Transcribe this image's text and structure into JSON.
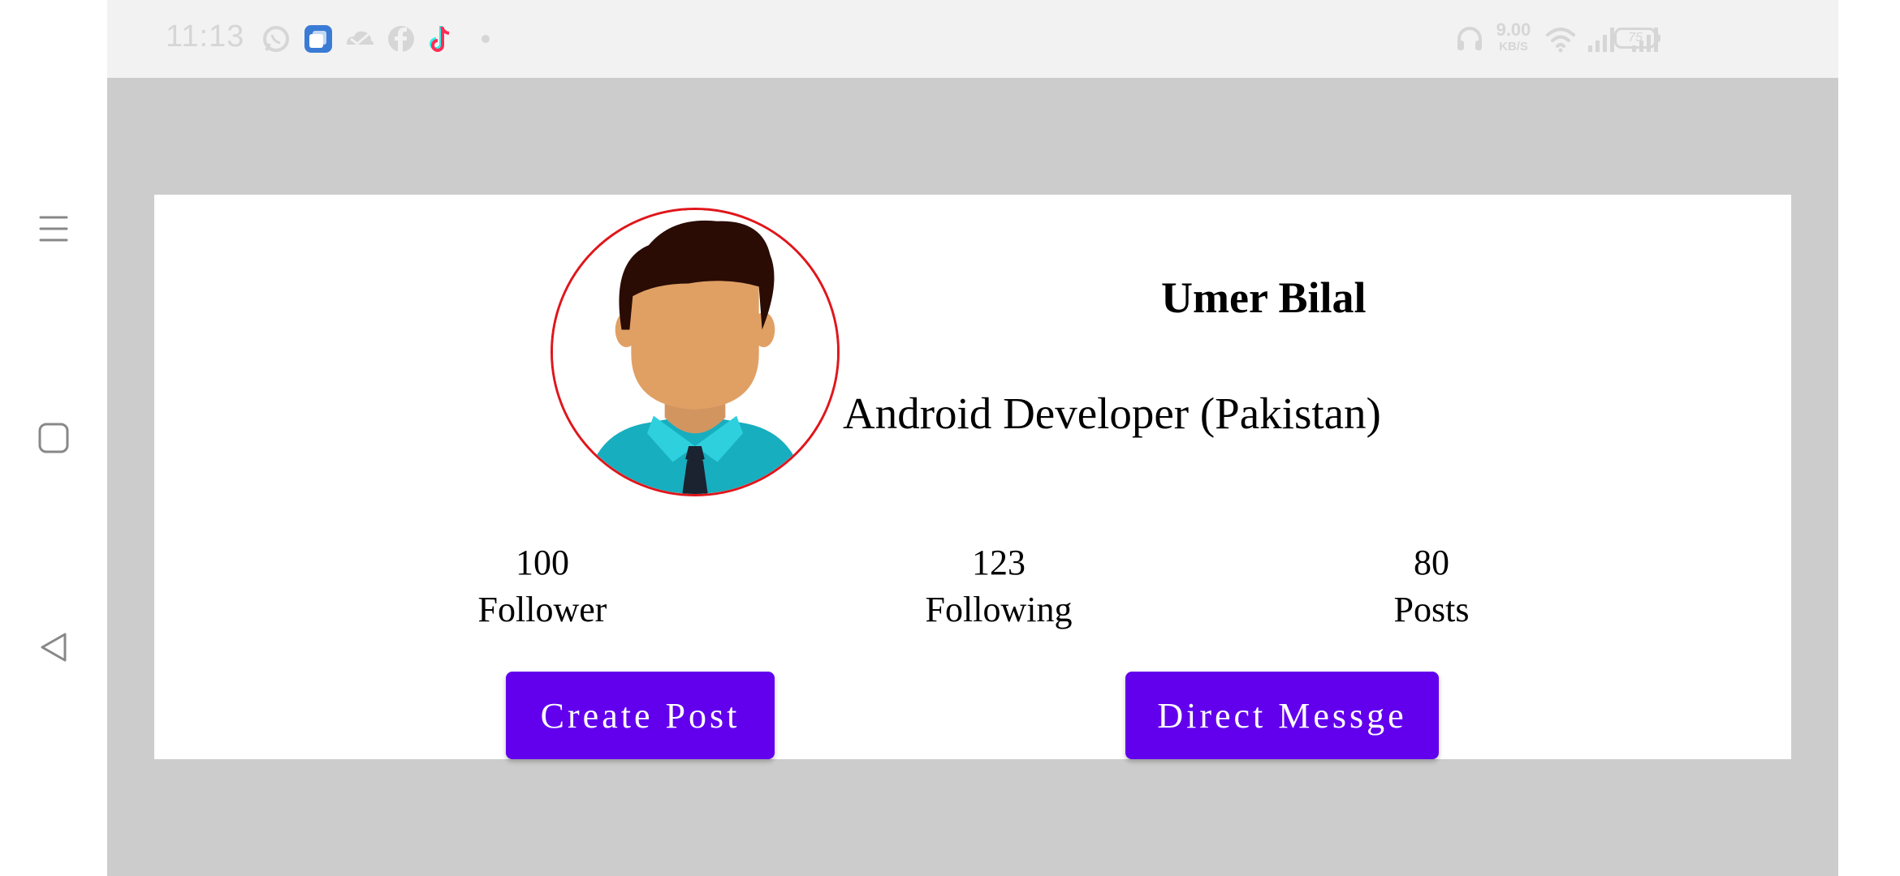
{
  "status_bar": {
    "time": "11:13",
    "network_speed_value": "9.00",
    "network_speed_unit": "KB/S",
    "battery_level": "75",
    "icons": [
      "whatsapp-icon",
      "multitask-app-icon",
      "cloud-app-icon",
      "facebook-icon",
      "tiktok-icon",
      "dot-icon",
      "headphones-icon",
      "wifi-icon",
      "signal-1-icon",
      "signal-2-icon",
      "battery-icon"
    ]
  },
  "nav_bar": {
    "icons": [
      "menu-icon",
      "home-square-icon",
      "back-triangle-icon"
    ]
  },
  "profile": {
    "name": "Umer Bilal",
    "bio": "Android Developer (Pakistan)",
    "avatar_icon": "avatar-man-icon",
    "avatar_border_color": "#e0161b"
  },
  "stats": {
    "followers": {
      "value": "100",
      "label": "Follower"
    },
    "following": {
      "value": "123",
      "label": "Following"
    },
    "posts": {
      "value": "80",
      "label": "Posts"
    }
  },
  "actions": {
    "create_post_label": "Create Post",
    "direct_message_label": "Direct Messge"
  },
  "colors": {
    "accent": "#6200ee",
    "app_background": "#cccccc",
    "card_background": "#ffffff"
  }
}
